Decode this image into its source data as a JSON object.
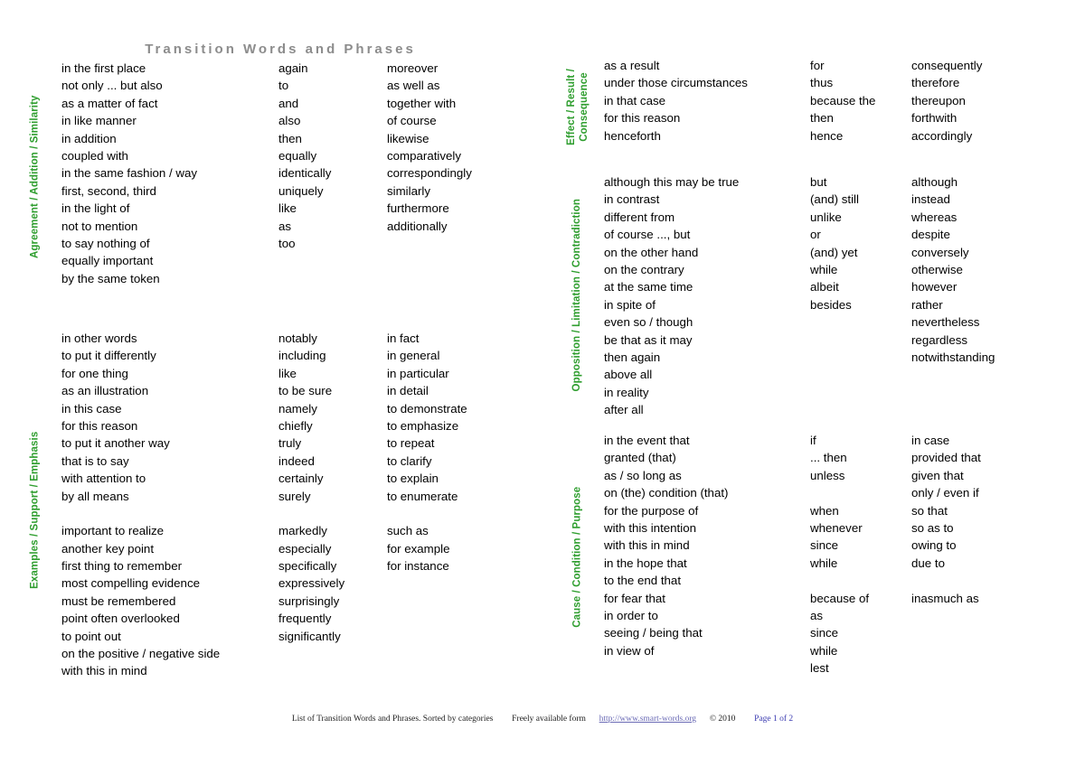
{
  "document": {
    "title": "Transition Words and Phrases",
    "title_color": "#8c8c8c",
    "category_color": "#2f9e2f"
  },
  "footer": {
    "description": "List of Transition Words and Phrases. Sorted by categories",
    "availability": "Freely available form",
    "url": "http://www.smart-words.org",
    "copyright": "© 2010",
    "page": "Page 1 of 2"
  },
  "columns_left": {
    "sections": [
      {
        "label_line1": "Agreement / Addition / Similarity",
        "label_line2": "",
        "col_a": [
          "in the first place",
          "not only ... but also",
          "as a matter of fact",
          "in like manner",
          "in addition",
          "coupled with",
          "in the same fashion / way",
          "first, second, third",
          "in the light of",
          "not to mention",
          "to say nothing of",
          "equally important",
          "by the same token"
        ],
        "col_b": [
          "again",
          "to",
          "and",
          "also",
          "then",
          "equally",
          "identically",
          "uniquely",
          "like",
          "as",
          "too"
        ],
        "col_c": [
          "moreover",
          "as well as",
          "together with",
          "of course",
          "likewise",
          "comparatively",
          "correspondingly",
          "similarly",
          "furthermore",
          "additionally"
        ]
      },
      {
        "label_line1": "Examples / Support / Emphasis",
        "label_line2": "",
        "col_a": [
          "in other words",
          "to put it differently",
          "for one thing",
          "as an illustration",
          "in this case",
          "for this reason",
          "to put it another way",
          "that is to say",
          "with attention to",
          "by all means",
          "",
          "important to realize",
          "another key point",
          "first thing to remember",
          "most compelling evidence",
          "must be remembered",
          "point often overlooked",
          "to point out",
          "on the positive / negative side",
          "with this in mind"
        ],
        "col_b": [
          "notably",
          "including",
          "like",
          "to be sure",
          "namely",
          "chiefly",
          "truly",
          "indeed",
          "certainly",
          "surely",
          "",
          "markedly",
          "especially",
          "specifically",
          "expressively",
          "surprisingly",
          "frequently",
          "significantly"
        ],
        "col_c": [
          "in fact",
          "in general",
          "in particular",
          "in detail",
          "to demonstrate",
          "to emphasize",
          "to repeat",
          "to clarify",
          "to explain",
          "to enumerate",
          "",
          "such as",
          "for example",
          "for instance"
        ]
      }
    ]
  },
  "columns_right": {
    "sections": [
      {
        "label_line1": "Effect / Result /",
        "label_line2": "Consequence",
        "col_a": [
          "as a result",
          "under those circumstances",
          "in that case",
          "for this reason",
          "henceforth"
        ],
        "col_b": [
          "for",
          "thus",
          "because the",
          "then",
          "hence"
        ],
        "col_c": [
          "consequently",
          "therefore",
          "thereupon",
          "forthwith",
          "accordingly"
        ]
      },
      {
        "label_line1": "Opposition / Limitation / Contradiction",
        "label_line2": "",
        "col_a": [
          "although this may be true",
          "in contrast",
          "different from",
          "of course ..., but",
          "on the other hand",
          "on the contrary",
          "at the same time",
          "in spite of",
          "even so / though",
          "be that as it may",
          "then again",
          "above all",
          "in reality",
          "after all"
        ],
        "col_b": [
          "but",
          "(and) still",
          "unlike",
          "or",
          "(and) yet",
          "while",
          "albeit",
          "besides"
        ],
        "col_c": [
          "although",
          "instead",
          "whereas",
          "despite",
          "conversely",
          "otherwise",
          "however",
          "rather",
          "nevertheless",
          "regardless",
          "notwithstanding"
        ]
      },
      {
        "label_line1": "Cause / Condition / Purpose",
        "label_line2": "",
        "col_a": [
          "in the event that",
          "granted (that)",
          "as / so long as",
          "on (the) condition (that)",
          "for the purpose of",
          "with this intention",
          "with this in mind",
          "in the hope that",
          "to the end that",
          "for fear that",
          "in order to",
          "seeing / being that",
          "in view of"
        ],
        "col_b": [
          "if",
          "... then",
          "unless",
          "",
          "when",
          "whenever",
          "since",
          "while",
          "",
          "because of",
          "as",
          "since",
          "while",
          "lest"
        ],
        "col_c": [
          "in case",
          "provided that",
          "given that",
          "only / even if",
          "so that",
          "so as to",
          "owing to",
          "due to",
          "",
          "inasmuch as"
        ]
      }
    ]
  },
  "layout": {
    "left_section_tops": [
      66,
      365
    ],
    "left_section_heights": [
      260,
      400
    ],
    "right_section_tops": [
      63,
      192,
      478
    ],
    "right_section_heights": [
      110,
      270,
      278
    ]
  }
}
